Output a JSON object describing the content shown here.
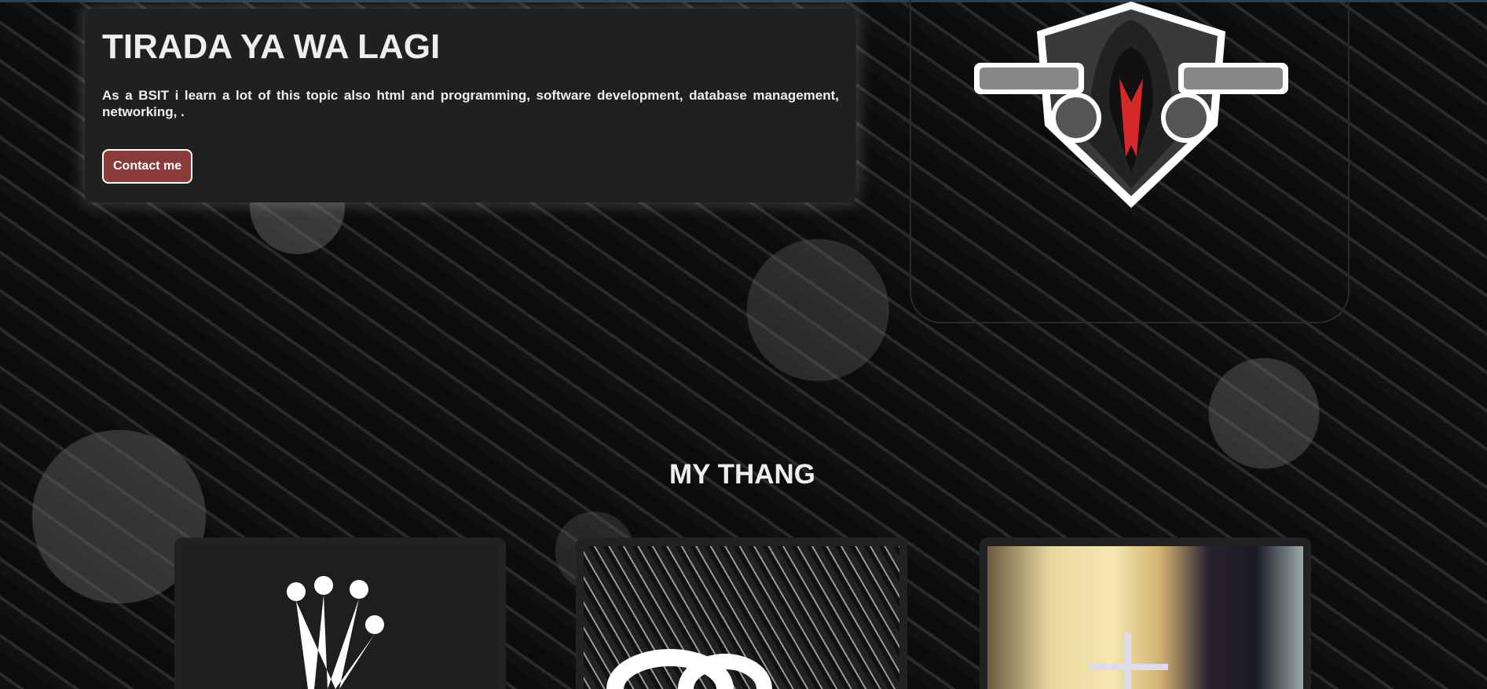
{
  "hero": {
    "title": "TIRADA YA WA LAGI",
    "description": "As a BSIT i learn a lot of this topic also html and programming, software development, database management, networking, .",
    "contact_label": "Contact me"
  },
  "logo": {
    "icon": "hooded-figure-with-guns-logo"
  },
  "section": {
    "title": "MY THANG",
    "cards": [
      {
        "icon": "crown-graffiti-image"
      },
      {
        "icon": "stussy-graffiti-image"
      },
      {
        "icon": "blurred-storefront-image"
      }
    ]
  },
  "colors": {
    "card": "#202020",
    "button": "#8b3a3a",
    "text": "#eeeeee"
  }
}
